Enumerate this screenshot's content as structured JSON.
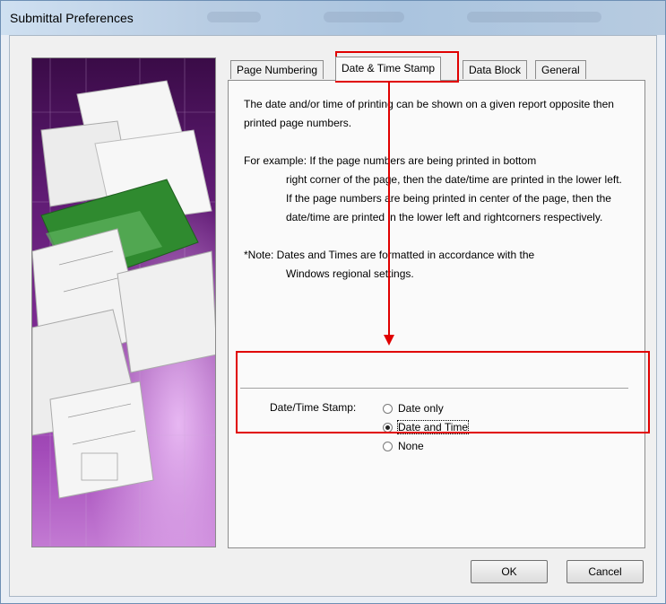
{
  "window": {
    "title": "Submittal Preferences"
  },
  "tabs": [
    {
      "label": "Page Numbering",
      "active": false
    },
    {
      "label": "Date & Time Stamp",
      "active": true
    },
    {
      "label": "Data Block",
      "active": false
    },
    {
      "label": "General",
      "active": false
    }
  ],
  "description": {
    "p1": "The date and/or time of printing can be shown on a given report opposite then printed page numbers.",
    "p2_first": "For example: If the page numbers are being printed in bottom",
    "p2_rest": "right corner of the page, then the date/time are printed in the lower left.  If the page numbers are being printed in center of the page, then the date/time are printed in the lower left and rightcorners respectively.",
    "p3_first": "*Note: Dates and Times are formatted in accordance with the",
    "p3_rest": "Windows regional settings."
  },
  "stamp": {
    "label": "Date/Time Stamp:",
    "options": [
      "Date only",
      "Date and Time",
      "None"
    ],
    "selected": "Date and Time"
  },
  "buttons": {
    "ok": "OK",
    "cancel": "Cancel"
  },
  "colors": {
    "highlight": "#e00000",
    "art_purple": "#7d2b92",
    "art_green": "#2f8a2f"
  },
  "icons": {
    "art": "blueprint-pages-illustration"
  }
}
